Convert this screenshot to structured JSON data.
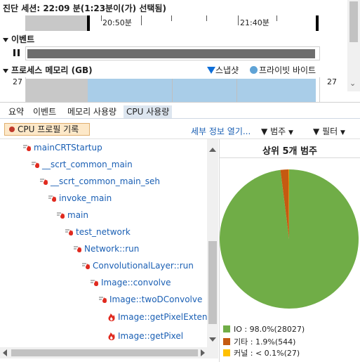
{
  "session": {
    "title": "진단 세션: 22:09 분(1:23분이(가) 선택됨)",
    "time_labels": [
      "20:50분",
      "21:40분"
    ]
  },
  "events": {
    "title": "이벤트"
  },
  "memory": {
    "title": "프로세스 메모리 (GB)",
    "legend_snapshot": "스냅샷",
    "legend_private": "프라이빗 바이트",
    "y_left": "27",
    "y_right": "27"
  },
  "tabs": [
    {
      "label": "요약"
    },
    {
      "label": "이벤트"
    },
    {
      "label": "메모리 사용량"
    },
    {
      "label": "CPU 사용량"
    }
  ],
  "toolbar": {
    "record_label": "CPU 프로필 기록",
    "details_label": "세부 정보 열기...",
    "category_label": "범주",
    "filter_label": "필터"
  },
  "tree": [
    {
      "label": "mainCRTStartup"
    },
    {
      "label": "__scrt_common_main"
    },
    {
      "label": "__scrt_common_main_seh"
    },
    {
      "label": "invoke_main"
    },
    {
      "label": "main"
    },
    {
      "label": "test_network"
    },
    {
      "label": "Network::run"
    },
    {
      "label": "ConvolutionalLayer::run"
    },
    {
      "label": "Image::convolve"
    },
    {
      "label": "Image::twoDConvolve"
    },
    {
      "label": "Image::getPixelExtend"
    },
    {
      "label": "Image::getPixel"
    }
  ],
  "chart_data": {
    "type": "pie",
    "title": "상위 5개 범주",
    "categories": [
      "IO",
      "기타",
      "커널"
    ],
    "values": [
      98.0,
      1.9,
      0.1
    ],
    "colors": [
      "#70ad47",
      "#c55a11",
      "#ffc000"
    ],
    "legend": [
      "IO : 98.0%(28027)",
      "기타 : 1.9%(544)",
      "커널 : < 0.1%(27)"
    ],
    "legend_placement": "bottom-left"
  }
}
